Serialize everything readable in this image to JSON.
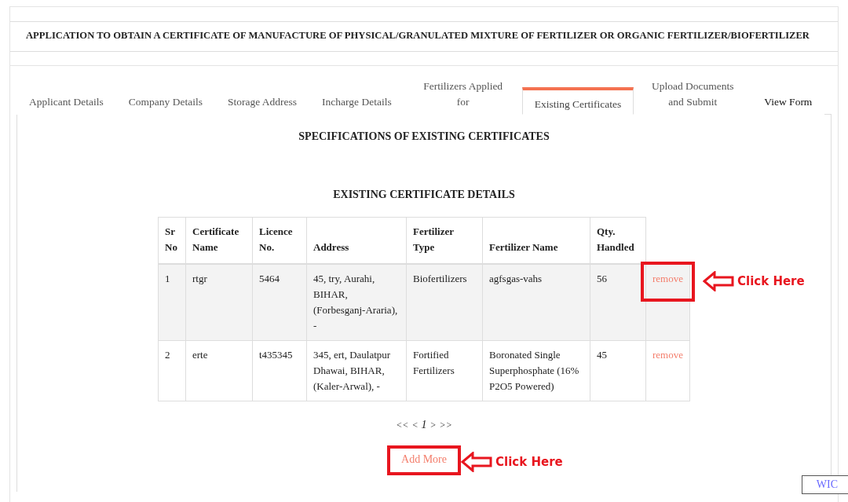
{
  "title": "APPLICATION TO OBTAIN A CERTIFICATE OF MANUFACTURE OF PHYSICAL/GRANULATED MIXTURE OF FERTILIZER OR ORGANIC FERTILIZER/BIOFERTILIZER",
  "tabs": [
    {
      "label": "Applicant Details",
      "selected": false
    },
    {
      "label": "Company Details",
      "selected": false
    },
    {
      "label": "Storage Address",
      "selected": false
    },
    {
      "label": "Incharge Details",
      "selected": false
    },
    {
      "label": "Fertilizers Applied for",
      "selected": false
    },
    {
      "label": "Existing Certificates",
      "selected": true
    },
    {
      "label": "Upload Documents and Submit",
      "selected": false
    },
    {
      "label": "View Form",
      "selected": false
    }
  ],
  "section_heading": "SPECIFICATIONS OF EXISTING CERTIFICATES",
  "table": {
    "heading": "EXISTING CERTIFICATE DETAILS",
    "columns": [
      "Sr No",
      "Certificate Name",
      "Licence No.",
      "Address",
      "Fertilizer Type",
      "Fertilizer Name",
      "Qty. Handled"
    ],
    "rows": [
      {
        "cells": [
          "1",
          "rtgr",
          "5464",
          "45, try, Aurahi, BIHAR, (Forbesganj-Araria), -",
          "Biofertilizers",
          "agfsgas-vahs",
          "56"
        ],
        "action": "remove",
        "hovered": true,
        "annotation": "Click Here"
      },
      {
        "cells": [
          "2",
          "erte",
          "t435345",
          "345, ert, Daulatpur Dhawai, BIHAR, (Kaler-Arwal), -",
          "Fortified Fertilizers",
          "Boronated Single Superphosphate (16% P2O5 Powered)",
          "45"
        ],
        "action": "remove",
        "hovered": false
      }
    ]
  },
  "pagination": [
    "<<",
    "<",
    "1",
    ">",
    ">>"
  ],
  "add_button": {
    "label": "Add More",
    "annotation": "Click Here"
  },
  "corner_widget": "WIC"
}
